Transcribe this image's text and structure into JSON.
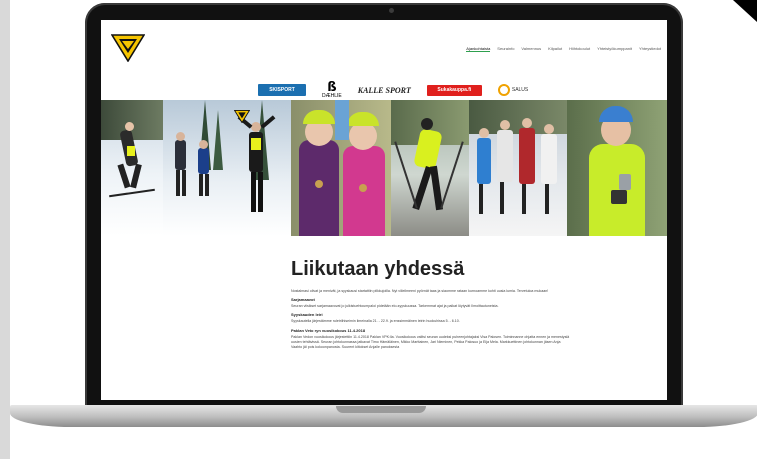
{
  "site": {
    "nav": [
      {
        "label": "Ajankohtaista",
        "active": true
      },
      {
        "label": "Seurainfo",
        "active": false
      },
      {
        "label": "Valmennus",
        "active": false
      },
      {
        "label": "Kilpailut",
        "active": false
      },
      {
        "label": "Hiihtokoulut",
        "active": false
      },
      {
        "label": "Yhteistyökumppanit",
        "active": false
      },
      {
        "label": "Yhteystiedot",
        "active": false
      }
    ],
    "sponsors": [
      {
        "name": "SKISPORT",
        "icon": "skisport-logo"
      },
      {
        "name": "DÆHLIE",
        "icon": "daehlie-logo"
      },
      {
        "name": "KALLE SPORT",
        "icon": "kalle-sport-logo"
      },
      {
        "name": "Sukakauppa.fi",
        "icon": "suka-logo"
      },
      {
        "name": "SALUS",
        "icon": "salus-logo"
      }
    ]
  },
  "article": {
    "title": "Liikutaan yhdessä",
    "intro": "Nostalmasi olivat ja menivät, ja syyskausi startattiin pilkkujoilla. Nyt viileilmeeni pyörnät taas ja siaomme rataan kurnoamme kohti uusia lumia. Tervetuloa mukaan!",
    "sections": [
      {
        "heading": "Sarjamaavot",
        "text": "Seuran viisikset sarjamaavovat jo julkistuehtoumpaloi pidetään elo-syyskuussa. Tarkemmat ajat ja paikat löytyvät Ilmoittautuneista."
      },
      {
        "heading": "Syyskauden leiri",
        "text": "Syyskautella järjestämme ruletriihiseimin ilmeinalla 21. - 22.9. ja enssimmäinen leirin huokuhissa 5. - 6.10."
      }
    ],
    "news_title": "Paklan Veto ryn vuosikokous 11.4.2018",
    "news_text": "Paklan Vedon vuosikokous järjestettiin 11.4.2018 Paklan VPK:lla. Vuosikokous valitsi seuran uudeksi puheenjohtajaksi Visa Palosen. Toiminnanne ohjatta ennen ja menestysiä uusien tehtävissä. Seuran johtokunnassa jatkavat Timo Hämäläinen, Mikko Marttainen, Jari Nieminen, Pekka Palosuo ja Eija Mela. Markkuettinen johtokunnan jäsen Anja Vaahto jäi pois kokoonpanosta. Suurent kiitokset Anjalle panoksesta"
  },
  "colors": {
    "nav_active_underline": "#2ea04e",
    "logo_yellow": "#f5c400",
    "skisport_blue": "#1b6fb0",
    "suka_red": "#e0201d",
    "salus_orange": "#f0a200"
  }
}
